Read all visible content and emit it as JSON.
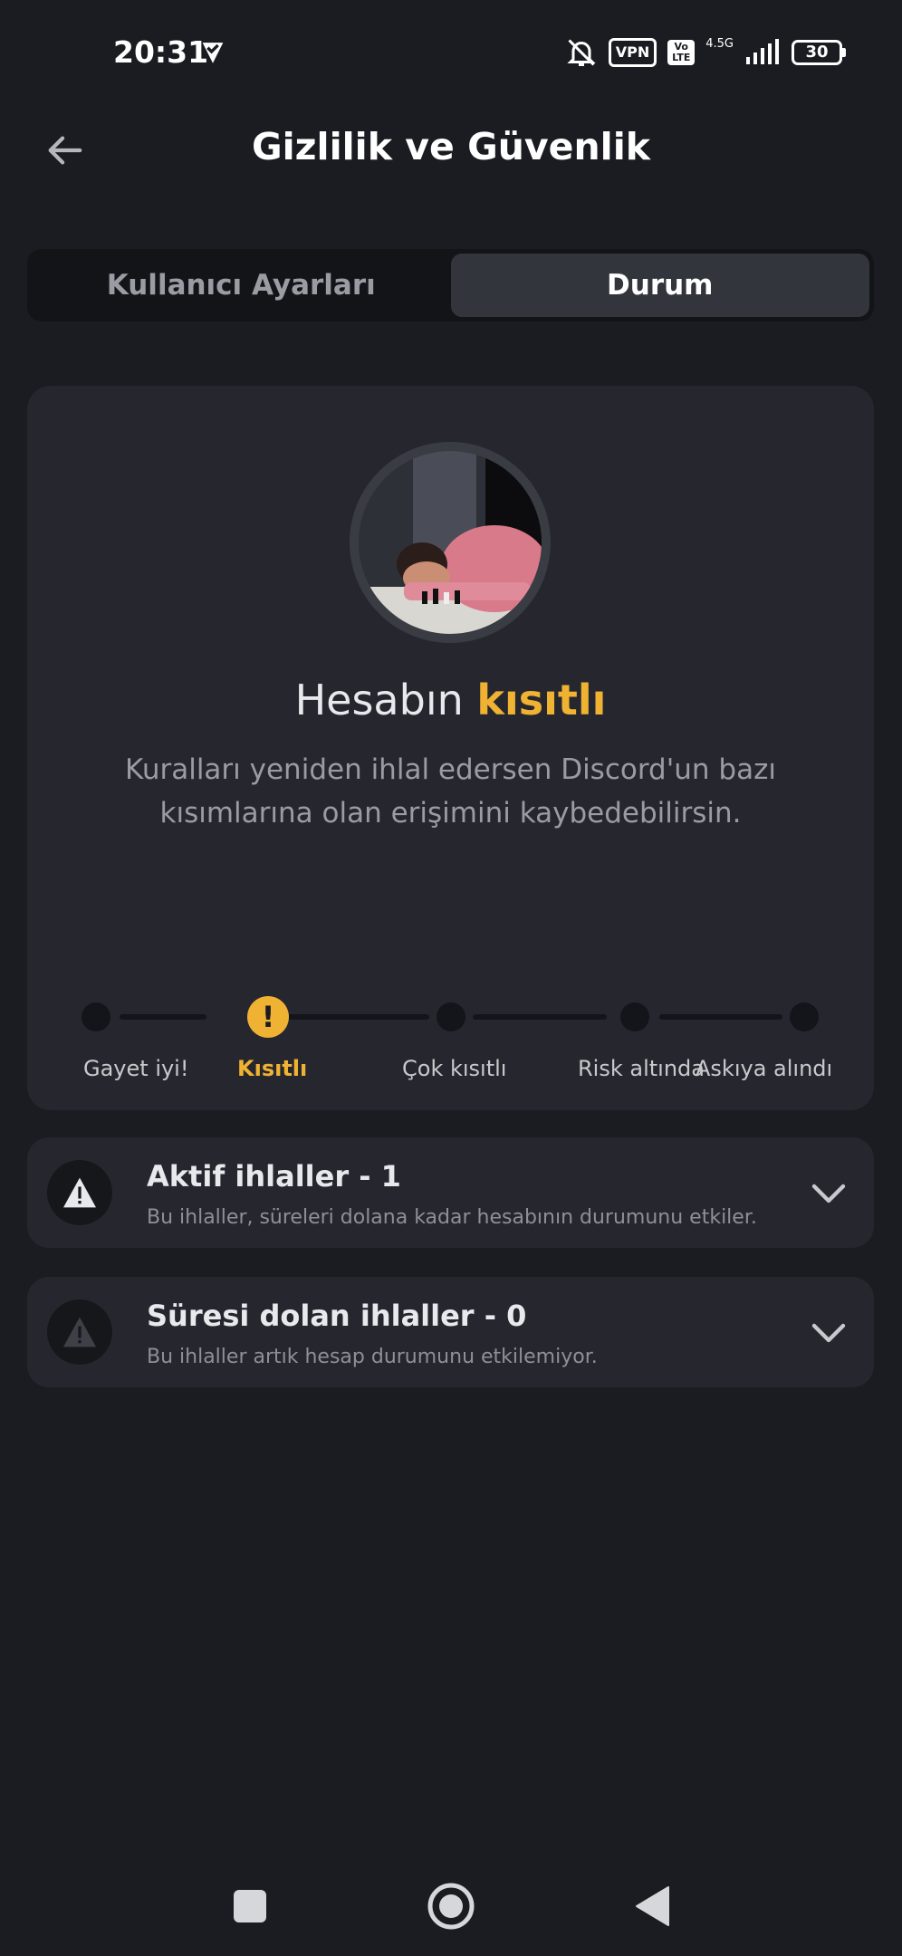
{
  "status_bar": {
    "time": "20:31",
    "vpn_label": "VPN",
    "volte_label": "Vo LTE",
    "network_type": "4.5G",
    "battery_level": "30"
  },
  "header": {
    "title": "Gizlilik ve Güvenlik"
  },
  "tabs": [
    {
      "label": "Kullanıcı Ayarları",
      "active": false
    },
    {
      "label": "Durum",
      "active": true
    }
  ],
  "status_card": {
    "status_prefix": "Hesabın ",
    "status_value": "kısıtlı",
    "description": "Kuralları yeniden ihlal edersen Discord'un bazı kısımlarına olan erişimini kaybedebilirsin.",
    "steps": [
      {
        "label": "Gayet iyi!",
        "current": false
      },
      {
        "label": "Kısıtlı",
        "current": true,
        "icon": "exclamation"
      },
      {
        "label": "Çok kısıtlı",
        "current": false
      },
      {
        "label": "Risk altında",
        "current": false
      },
      {
        "label": "Askıya alındı",
        "current": false
      }
    ]
  },
  "violations": [
    {
      "title": "Aktif ihlaller - 1",
      "subtitle": "Bu ihlaller, süreleri dolana kadar hesabının durumunu etkiler.",
      "icon": "warning-triangle-icon"
    },
    {
      "title": "Süresi dolan ihlaller - 0",
      "subtitle": "Bu ihlaller artık hesap durumunu etkilemiyor.",
      "icon": "warning-triangle-icon"
    }
  ],
  "colors": {
    "background": "#1b1c21",
    "card": "#26272e",
    "accent_warning": "#f0b232",
    "text_primary": "#f2f3f5",
    "text_muted": "#9a9ca3"
  }
}
